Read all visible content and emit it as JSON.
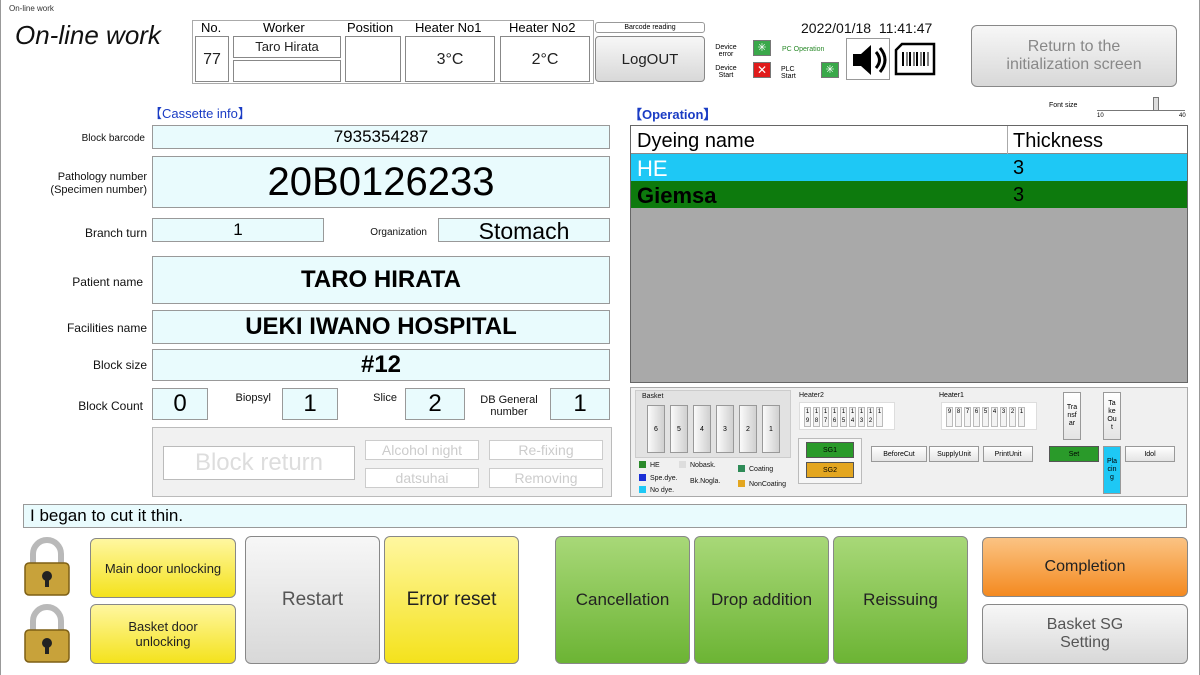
{
  "window_title": "On-line work",
  "page_title": "On-line work",
  "header": {
    "no_label": "No.",
    "no_value": "77",
    "worker_label": "Worker",
    "worker_value": "Taro Hirata",
    "position_label": "Position",
    "heater1_label": "Heater No1",
    "heater1_value": "3°C",
    "heater2_label": "Heater No2",
    "heater2_value": "2°C",
    "barcode_reading": "Barcode reading",
    "logout": "LogOUT",
    "device_error": "Device error",
    "device_start": "Device Start",
    "pc_operation": "PC Operation",
    "plc_start": "PLC Start",
    "datetime": "2022/01/18  11:41:47",
    "return_btn": "Return to the initialization screen",
    "font_size": "Font size",
    "font_min": "10",
    "font_max": "40"
  },
  "cassette": {
    "title": "【Cassette info】",
    "block_barcode_label": "Block barcode",
    "block_barcode": "7935354287",
    "pathology_label": "Pathology number (Specimen number)",
    "pathology": "20B0126233",
    "branch_label": "Branch turn",
    "branch": "1",
    "organization_label": "Organization",
    "organization": "Stomach",
    "patient_label": "Patient name",
    "patient": "TARO HIRATA",
    "facilities_label": "Facilities name",
    "facilities": "UEKI IWANO HOSPITAL",
    "block_size_label": "Block size",
    "block_size": "#12",
    "block_count_label": "Block Count",
    "block_count": "0",
    "biopsyl_label": "Biopsyl",
    "biopsyl": "1",
    "slice_label": "Slice",
    "slice": "2",
    "db_label": "DB General number",
    "db": "1",
    "block_return": "Block return",
    "alcohol": "Alcohol night",
    "refixing": "Re-fixing",
    "datsuhai": "datsuhai",
    "removing": "Removing"
  },
  "operation": {
    "title": "【Operation】",
    "col1": "Dyeing name",
    "col2": "Thickness",
    "rows": [
      {
        "name": "HE",
        "thickness": "3",
        "color": "#1ec8f5"
      },
      {
        "name": "Giemsa",
        "thickness": "3",
        "color": "#0d7a0d"
      }
    ]
  },
  "status": {
    "basket": "Basket",
    "slots": [
      "6",
      "5",
      "4",
      "3",
      "2",
      "1"
    ],
    "heater2": "Heater2",
    "heater1": "Heater1",
    "h2_top": [
      "1",
      "1",
      "1",
      "1",
      "1",
      "1",
      "1",
      "1"
    ],
    "h2_bot": [
      "9",
      "8",
      "7",
      "6",
      "5",
      "4",
      "3",
      "2",
      "1"
    ],
    "h1_nums": [
      "9",
      "8",
      "7",
      "6",
      "5",
      "4",
      "3",
      "2",
      "1"
    ],
    "sg1": "SG1",
    "sg2": "SG2",
    "before_cut": "BeforeCut",
    "supply_unit": "SupplyUnit",
    "print_unit": "PrintUnit",
    "transfer": "Tra nsf ar",
    "take_out": "Ta ke Ou t",
    "set": "Set",
    "placing": "Pla cin g",
    "idol": "Idol",
    "legend": {
      "he": "HE",
      "spedye": "Spe.dye.",
      "nodye": "No dye.",
      "nobask": "Nobask.",
      "bknogla": "Bk.Nogla.",
      "coating": "Coating",
      "noncoating": "NonCoating"
    }
  },
  "message": "I began to cut it thin.",
  "buttons": {
    "main_door": "Main door unlocking",
    "basket_door": "Basket door unlocking",
    "restart": "Restart",
    "error_reset": "Error reset",
    "cancellation": "Cancellation",
    "drop_addition": "Drop addition",
    "reissuing": "Reissuing",
    "completion": "Completion",
    "basket_sg": "Basket SG Setting"
  }
}
